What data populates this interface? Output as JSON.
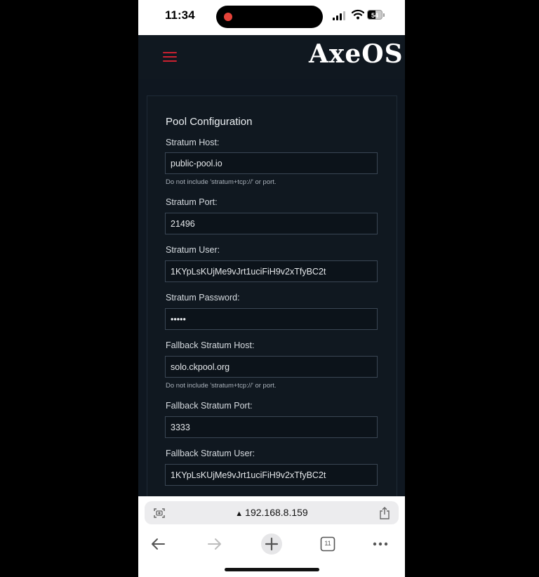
{
  "status_bar": {
    "time": "11:34",
    "battery": "54"
  },
  "app": {
    "logo": "AxeOS",
    "section_title": "Pool Configuration",
    "fields": [
      {
        "label": "Stratum Host:",
        "value": "public-pool.io",
        "hint": "Do not include 'stratum+tcp://' or port."
      },
      {
        "label": "Stratum Port:",
        "value": "21496"
      },
      {
        "label": "Stratum User:",
        "value": "1KYpLsKUjMe9vJrt1uciFiH9v2xTfyBC2t"
      },
      {
        "label": "Stratum Password:",
        "value": "•••••"
      },
      {
        "label": "Fallback Stratum Host:",
        "value": "solo.ckpool.org",
        "hint": "Do not include 'stratum+tcp://' or port."
      },
      {
        "label": "Fallback Stratum Port:",
        "value": "3333"
      },
      {
        "label": "Fallback Stratum User:",
        "value": "1KYpLsKUjMe9vJrt1uciFiH9v2xTfyBC2t"
      }
    ]
  },
  "browser": {
    "url": "192.168.8.159",
    "tabs_count": "11"
  },
  "colors": {
    "accent": "#cc2130",
    "background": "#0f1720",
    "field_border": "#3a4654"
  }
}
